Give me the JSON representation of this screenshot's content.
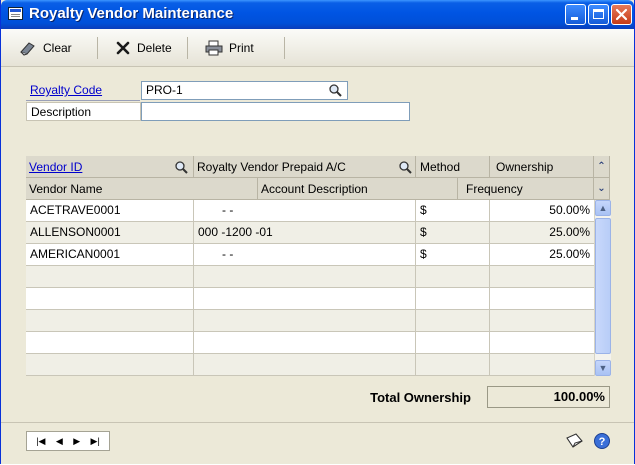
{
  "window": {
    "title": "Royalty Vendor Maintenance"
  },
  "toolbar": {
    "clear_label": "Clear",
    "delete_label": "Delete",
    "print_label": "Print"
  },
  "form": {
    "royalty_code_label": "Royalty Code",
    "royalty_code_value": "PRO-1",
    "description_label": "Description",
    "description_value": ""
  },
  "grid": {
    "headers_row1": [
      "Vendor ID",
      "Royalty Vendor Prepaid A/C",
      "Method",
      "Ownership"
    ],
    "headers_row2": [
      "Vendor Name",
      "Account Description",
      "Frequency"
    ],
    "rows": [
      {
        "vendor_id": "ACETRAVE0001",
        "prepaid_ac": "-   -",
        "method": "$",
        "ownership": "50.00%"
      },
      {
        "vendor_id": "ALLENSON0001",
        "prepaid_ac": "000 -1200 -01",
        "method": "$",
        "ownership": "25.00%"
      },
      {
        "vendor_id": "AMERICAN0001",
        "prepaid_ac": "-   -",
        "method": "$",
        "ownership": "25.00%"
      },
      {
        "vendor_id": "",
        "prepaid_ac": "",
        "method": "",
        "ownership": ""
      },
      {
        "vendor_id": "",
        "prepaid_ac": "",
        "method": "",
        "ownership": ""
      },
      {
        "vendor_id": "",
        "prepaid_ac": "",
        "method": "",
        "ownership": ""
      },
      {
        "vendor_id": "",
        "prepaid_ac": "",
        "method": "",
        "ownership": ""
      },
      {
        "vendor_id": "",
        "prepaid_ac": "",
        "method": "",
        "ownership": ""
      }
    ]
  },
  "total": {
    "label": "Total Ownership",
    "value": "100.00%"
  },
  "colors": {
    "title_bar": "#0054e3",
    "link": "#0000cc",
    "window_bg": "#ece9d8"
  }
}
